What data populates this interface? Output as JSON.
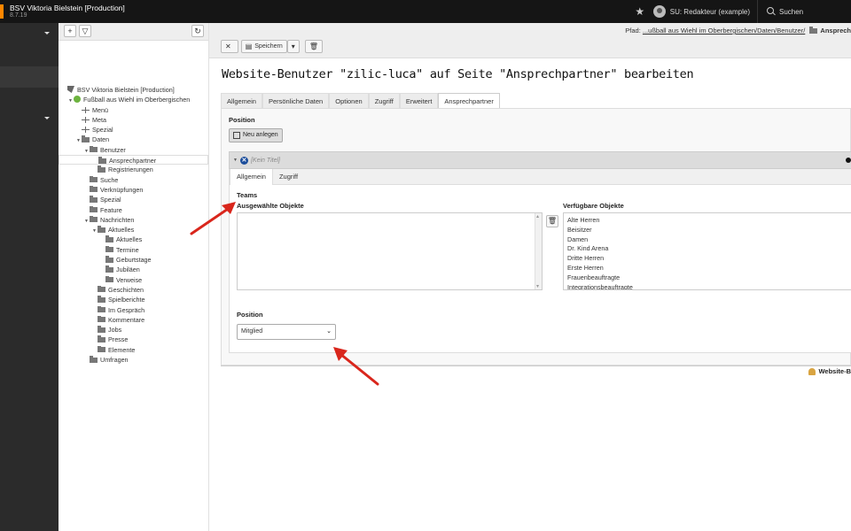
{
  "topbar": {
    "site_name": "BSV Viktoria Bielstein [Production]",
    "version": "8.7.19",
    "star_icon": "star-icon",
    "user_label": "SU: Redakteur (example)",
    "search_label": "Suchen"
  },
  "tree_toolbar": {
    "new_page_icon": "new-page-icon",
    "filter_icon": "filter-icon",
    "refresh_icon": "refresh-icon"
  },
  "tree": {
    "root": "BSV Viktoria Bielstein [Production]",
    "site": "Fußball aus Wiehl im Oberbergischen",
    "items": {
      "menu": "Menü",
      "meta": "Meta",
      "spezial": "Spezial",
      "daten": "Daten",
      "benutzer": "Benutzer",
      "ansprechpartner": "Ansprechpartner",
      "registrierungen": "Registrierungen",
      "suche": "Suche",
      "verknuepfungen": "Verknüpfungen",
      "spezial2": "Spezial",
      "feature": "Feature",
      "nachrichten": "Nachrichten",
      "aktuelles": "Aktuelles",
      "aktuelles2": "Aktuelles",
      "termine": "Termine",
      "geburtstage": "Geburtstage",
      "jubilaeen": "Jubiläen",
      "verweise": "Verweise",
      "geschichten": "Geschichten",
      "spielberichte": "Spielberichte",
      "im_gespraech": "Im Gespräch",
      "kommentare": "Kommentare",
      "jobs": "Jobs",
      "presse": "Presse",
      "elemente": "Elemente",
      "umfragen": "Umfragen"
    }
  },
  "docheader": {
    "path_label": "Pfad:",
    "path_link": "...ußball aus Wiehl im Oberbergischen/Daten/Benutzer/",
    "path_current": "Ansprech",
    "save_label": "Speichern"
  },
  "page_title": "Website-Benutzer \"zilic-luca\" auf Seite \"Ansprechpartner\" bearbeiten",
  "tabs": [
    "Allgemein",
    "Persönliche Daten",
    "Optionen",
    "Zugriff",
    "Erweitert",
    "Ansprechpartner"
  ],
  "active_tab": "Ansprechpartner",
  "panel": {
    "position_label": "Position",
    "new_button": "Neu anlegen",
    "record_title": "[Kein Titel]",
    "inner_tabs": [
      "Allgemein",
      "Zugriff"
    ],
    "teams_label": "Teams",
    "selected_label": "Ausgewählte Objekte",
    "available_label": "Verfügbare Objekte",
    "available_items": [
      "Alte Herren",
      "Beisitzer",
      "Damen",
      "Dr. Kind Arena",
      "Dritte Herren",
      "Erste Herren",
      "Frauenbeauftragte",
      "Integrationsbeauftragte"
    ],
    "position_field_label": "Position",
    "position_value": "Mitglied"
  },
  "footer": {
    "record_type": "Website-B"
  },
  "colors": {
    "topbar": "#151515",
    "module_menu": "#2b2b2b",
    "accent_orange": "#ff8700",
    "annotation_arrow": "#d9261c"
  }
}
